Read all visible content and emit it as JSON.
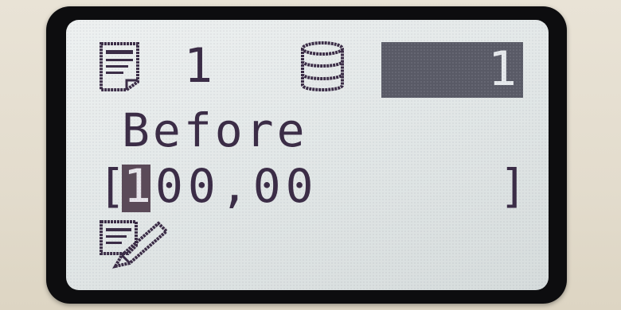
{
  "display": {
    "copies_value": "1",
    "counter_value": "1",
    "label": "Before",
    "bracket_open": "[",
    "cursor_digit": "1",
    "value_rest": "00,00",
    "bracket_close": "]"
  },
  "icons": {
    "page": "page-icon",
    "stack": "paper-stack-icon",
    "edit": "edit-document-icon"
  },
  "colors": {
    "lcd_background": "#e2e7e7",
    "lcd_foreground": "#3b2c46",
    "highlight_box": "#595a66",
    "bezel": "#0d0d0f",
    "housing": "#e5dfd1"
  }
}
